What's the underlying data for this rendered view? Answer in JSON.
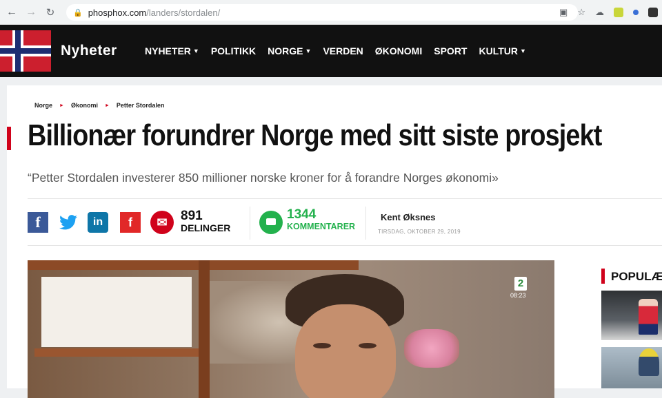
{
  "browser": {
    "back": "←",
    "forward": "→",
    "reload": "C",
    "url_domain": "phosphox.com",
    "url_path": "/landers/stordalen/"
  },
  "site": {
    "name": "Nyheter",
    "nav": [
      {
        "label": "NYHETER",
        "dropdown": true
      },
      {
        "label": "POLITIKK",
        "dropdown": false
      },
      {
        "label": "NORGE",
        "dropdown": true
      },
      {
        "label": "VERDEN",
        "dropdown": false
      },
      {
        "label": "ØKONOMI",
        "dropdown": false
      },
      {
        "label": "SPORT",
        "dropdown": false
      },
      {
        "label": "KULTUR",
        "dropdown": true
      }
    ],
    "caret": "▼"
  },
  "article": {
    "breadcrumb": [
      "Norge",
      "Økonomi",
      "Petter Stordalen"
    ],
    "breadcrumb_sep": "►",
    "headline": "Billionær forundrer Norge med sitt siste prosjekt",
    "subtitle": "“Petter Stordalen investerer 850 millioner norske kroner for å forandre Norges økonomi»",
    "share": {
      "facebook": "f",
      "twitter": "🐦",
      "linkedin": "in",
      "flipboard": "f",
      "mail": "✉",
      "count": "891",
      "count_label": "DELINGER"
    },
    "comments": {
      "count": "1344",
      "label": "KOMMENTARER"
    },
    "author": "Kent Øksnes",
    "date": "TIRSDAG, OKTOBER 29, 2019"
  },
  "hero": {
    "channel": "2",
    "time": "08:23"
  },
  "sidebar": {
    "title": "POPULÆ"
  },
  "colors": {
    "accent": "#d0021b",
    "header_bg": "#111111",
    "comment_green": "#23b14d"
  }
}
